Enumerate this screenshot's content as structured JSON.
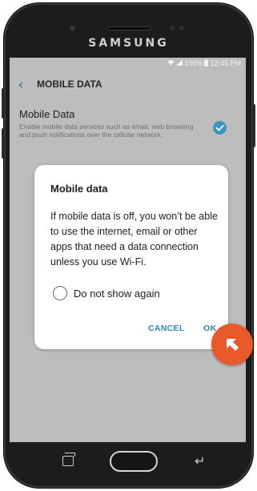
{
  "device": {
    "brand": "SAMSUNG"
  },
  "status_bar": {
    "battery": "100%",
    "time": "12:45 PM",
    "icons": [
      "wifi-icon",
      "signal-icon",
      "battery-icon"
    ]
  },
  "header": {
    "title": "MOBILE DATA",
    "back_icon": "chevron-left-icon"
  },
  "setting": {
    "title": "Mobile Data",
    "description": "Enable mobile data services such as email, web browsing and push notifications over the cellular network.",
    "checked": true
  },
  "dialog": {
    "title": "Mobile data",
    "body": "If mobile data is off, you won’t be able to use the internet, email or other apps that need a data connection unless you use Wi‑Fi.",
    "checkbox_label": "Do not show again",
    "cancel_label": "CANCEL",
    "ok_label": "OK"
  },
  "overlay": {
    "arrow_icon": "arrow-up-left-icon",
    "color": "#e95a2b"
  },
  "colors": {
    "accent": "#2f89b9",
    "check": "#3d95c2"
  }
}
